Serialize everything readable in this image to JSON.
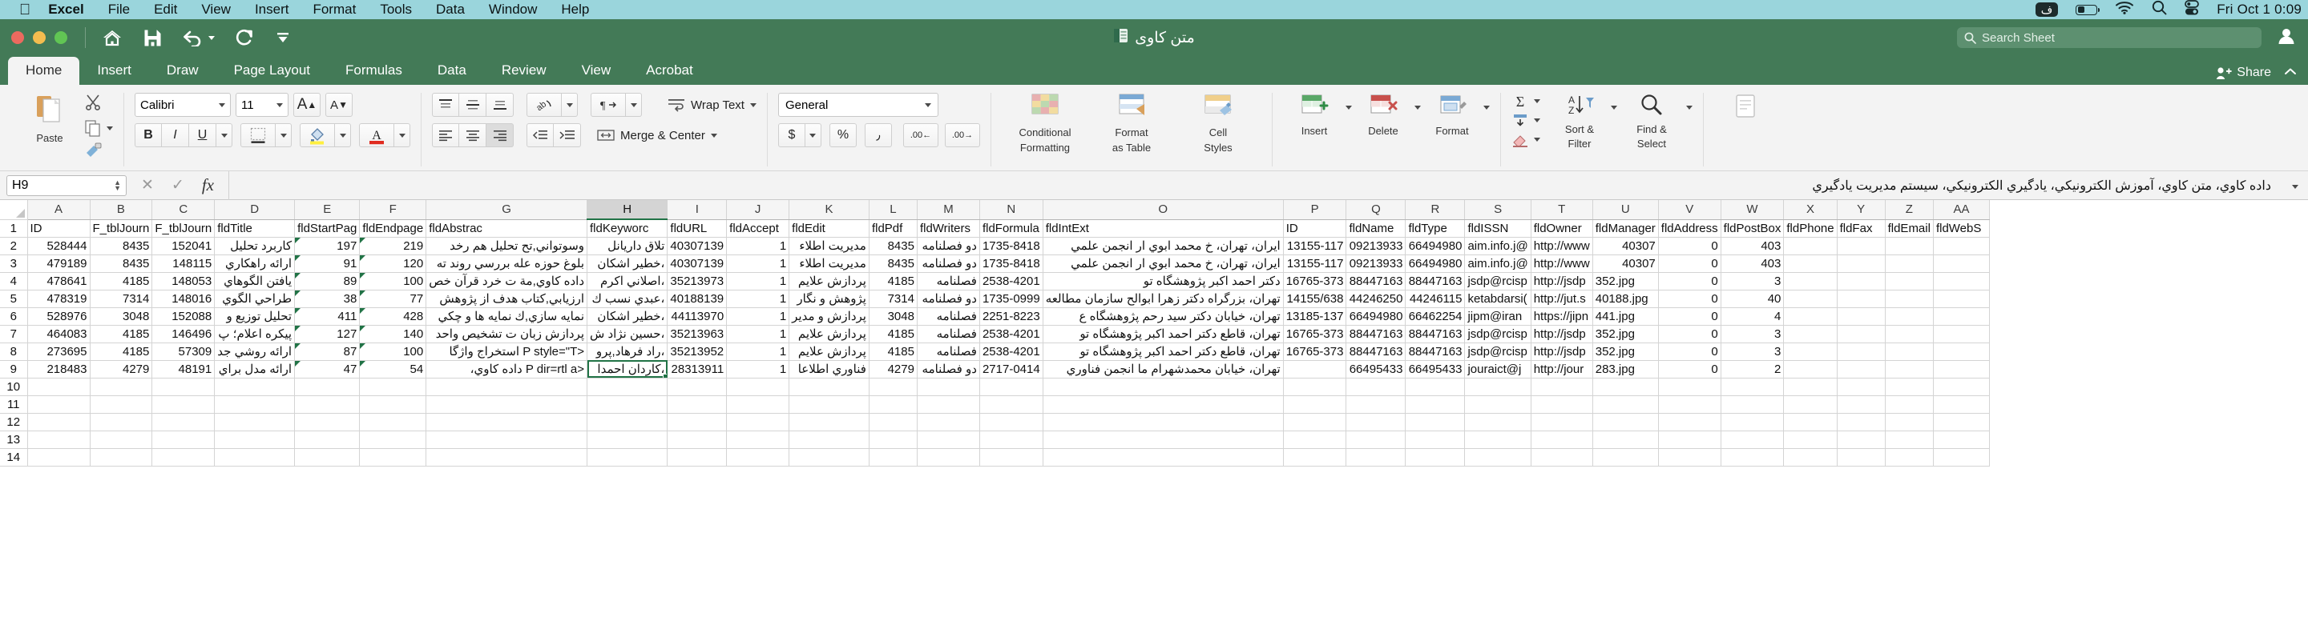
{
  "menubar": {
    "apple_icon": "apple-icon",
    "items": [
      "Excel",
      "File",
      "Edit",
      "View",
      "Insert",
      "Format",
      "Tools",
      "Data",
      "Window",
      "Help"
    ],
    "right": {
      "ime_label": "ف",
      "battery_icon": "battery-icon",
      "wifi_icon": "wifi-icon",
      "search_icon": "spotlight-search-icon",
      "control_center_icon": "control-center-icon",
      "clock": "Fri Oct 1  0:09"
    }
  },
  "window": {
    "title": "متن کاوی",
    "title_icon": "workbook-icon",
    "traffic_lights": [
      "close",
      "minimize",
      "zoom"
    ],
    "quick_access": [
      "home-icon",
      "save-icon",
      "undo-icon",
      "redo-icon",
      "customize-icon"
    ],
    "search_placeholder": "Search Sheet",
    "account_icon": "account-icon"
  },
  "ribbon": {
    "tabs": [
      "Home",
      "Insert",
      "Draw",
      "Page Layout",
      "Formulas",
      "Data",
      "Review",
      "View",
      "Acrobat"
    ],
    "active_tab": "Home",
    "share_label": "Share",
    "collapse_icon": "chevron-up-icon",
    "clipboard": {
      "paste_label": "Paste",
      "cut_icon": "scissors-icon",
      "copy_icon": "copy-icon",
      "format_painter_icon": "format-painter-icon"
    },
    "font": {
      "font_name": "Calibri",
      "font_size": "11",
      "grow_font": "A",
      "shrink_font": "A",
      "bold": "B",
      "italic": "I",
      "underline": "U",
      "borders_icon": "borders-icon",
      "fill_color_icon": "fill-color-icon",
      "fill_color": "#ffef3f",
      "font_color_icon": "font-color-icon",
      "font_color": "#e02b20"
    },
    "alignment": {
      "align_top_icon": "align-top-icon",
      "align_middle_icon": "align-middle-icon",
      "align_bottom_icon": "align-bottom-icon",
      "orientation_icon": "orientation-icon",
      "text_direction_icon": "text-direction-icon",
      "align_left_icon": "align-left-icon",
      "align_center_icon": "align-center-icon",
      "align_right_icon": "align-right-icon",
      "decrease_indent_icon": "decrease-indent-icon",
      "increase_indent_icon": "increase-indent-icon",
      "wrap_text_label": "Wrap Text",
      "merge_center_label": "Merge & Center"
    },
    "number": {
      "format": "General",
      "currency": "$",
      "percent": "%",
      "comma": "٫",
      "decrease_decimal": ".00",
      "increase_decimal": ".00"
    },
    "styles": {
      "conditional_formatting": "Conditional\nFormatting",
      "conditional_line1": "Conditional",
      "conditional_line2": "Formatting",
      "format_as_table_line1": "Format",
      "format_as_table_line2": "as Table",
      "cell_styles_line1": "Cell",
      "cell_styles_line2": "Styles"
    },
    "cells": {
      "insert_label": "Insert",
      "delete_label": "Delete",
      "format_label": "Format"
    },
    "editing": {
      "autosum_icon": "autosum-icon",
      "fill_icon": "fill-icon",
      "clear_icon": "clear-icon",
      "sort_filter_line1": "Sort &",
      "sort_filter_line2": "Filter",
      "find_select_line1": "Find &",
      "find_select_line2": "Select"
    },
    "sensitivity_icon": "sensitivity-icon"
  },
  "formula_bar": {
    "name_box": "H9",
    "cancel_icon": "cancel-icon",
    "enter_icon": "confirm-icon",
    "function_icon": "fx-icon",
    "value": "داده کاوي، متن کاوي، آموزش الکترونیکي، یادگیري الکترونیکي، سیستم مدیریت یادگیري",
    "expand_icon": "expand-formula-bar-icon"
  },
  "sheet": {
    "selected_cell": "H9",
    "selected_column": "H",
    "selected_row": 9,
    "columns": [
      {
        "label": "A",
        "width": 78
      },
      {
        "label": "B",
        "width": 74
      },
      {
        "label": "C",
        "width": 74
      },
      {
        "label": "D",
        "width": 78
      },
      {
        "label": "E",
        "width": 74
      },
      {
        "label": "F",
        "width": 74
      },
      {
        "label": "G",
        "width": 78
      },
      {
        "label": "H",
        "width": 78
      },
      {
        "label": "I",
        "width": 60
      },
      {
        "label": "J",
        "width": 78
      },
      {
        "label": "K",
        "width": 78
      },
      {
        "label": "L",
        "width": 60
      },
      {
        "label": "M",
        "width": 78
      },
      {
        "label": "N",
        "width": 78
      },
      {
        "label": "O",
        "width": 70
      },
      {
        "label": "P",
        "width": 74
      },
      {
        "label": "Q",
        "width": 74
      },
      {
        "label": "R",
        "width": 74
      },
      {
        "label": "S",
        "width": 74
      },
      {
        "label": "T",
        "width": 74
      },
      {
        "label": "U",
        "width": 80
      },
      {
        "label": "V",
        "width": 74
      },
      {
        "label": "W",
        "width": 74
      },
      {
        "label": "X",
        "width": 60
      },
      {
        "label": "Y",
        "width": 60
      },
      {
        "label": "Z",
        "width": 60
      },
      {
        "label": "AA",
        "width": 70
      }
    ],
    "row_numbers": [
      1,
      2,
      3,
      4,
      5,
      6,
      7,
      8,
      9,
      10,
      11,
      12,
      13,
      14
    ],
    "header_row": [
      "ID",
      "F_tblJourn",
      "F_tblJourn",
      "fldTitle",
      "fldStartPag",
      "fldEndpage",
      "fldAbstrac",
      "fldKeyworc",
      "fldURL",
      "fldAccept",
      "fldEdit",
      "fldPdf",
      "fldWriters",
      "fldFormula",
      "fldIntExt",
      "ID",
      "fldName",
      "fldType",
      "fldISSN",
      "fldOwner",
      "fldManager",
      "fldAddress",
      "fldPostBox",
      "fldPhone",
      "fldFax",
      "fldEmail",
      "fldWebS"
    ],
    "rows": [
      {
        "n": 2,
        "cells": [
          "528444",
          "8435",
          "152041",
          "كاربرد تحليل",
          "197",
          "219",
          "وسوتواني,تح تحليل هم رخد",
          "تلاق داريانل",
          "40307139",
          "1",
          "مديريت اطلاء",
          "8435",
          "دو فصلنامه",
          "1735-8418",
          "ايران، تهران، خ محمد ابوي ار انجمن علمي",
          "13155-117",
          "09213933",
          "66494980",
          "aim.info.j@",
          "http://www",
          "40307",
          "0",
          "403",
          "",
          "",
          ""
        ]
      },
      {
        "n": 3,
        "cells": [
          "479189",
          "8435",
          "148115",
          "ارائه راهكاري",
          "91",
          "120",
          "بلوغ حوزه عله بررسي روند ته",
          "،خطير اشكان",
          "40307139",
          "1",
          "مديريت اطلاء",
          "8435",
          "دو فصلنامه",
          "1735-8418",
          "ايران، تهران، خ محمد ابوي ار انجمن علمي",
          "13155-117",
          "09213933",
          "66494980",
          "aim.info.j@",
          "http://www",
          "40307",
          "0",
          "403",
          "",
          "",
          ""
        ]
      },
      {
        "n": 4,
        "cells": [
          "478641",
          "4185",
          "148053",
          "يافتن الگوهاي",
          "89",
          "100",
          "داده كاوي,مة ت خرد قرآن خص",
          "،اصلاني اكرم",
          "35213973",
          "1",
          "پردازش علايم",
          "4185",
          "فصلنامه",
          "2538-4201",
          "دكتر احمد اكبر پژوهشگاه تو",
          "16765-373",
          "88447163",
          "88447163",
          "jsdp@rcisp",
          "http://jsdp",
          "352.jpg",
          "0",
          "3",
          "",
          "",
          ""
        ]
      },
      {
        "n": 5,
        "cells": [
          "478319",
          "7314",
          "148016",
          "طراحي الگوي",
          "38",
          "77",
          "ارزيابي,كتاب هدف از پژوهش",
          "،عبدي نسب ك",
          "40188139",
          "1",
          "پژوهش و نگار",
          "7314",
          "دو فصلنامه",
          "1735-0999",
          "تهران، بزرگراه دكتر زهرا ابوالح سازمان مطالعه",
          "14155/638",
          "44246250",
          "44246115",
          "ketabdarsi(",
          "http://jut.s",
          "40188.jpg",
          "0",
          "40",
          "",
          "",
          ""
        ]
      },
      {
        "n": 6,
        "cells": [
          "528976",
          "3048",
          "152088",
          "تحليل توزيع و",
          "411",
          "428",
          "نمايه سازي,ك نمايه ها و چكي",
          "،خطير اشكان",
          "44113970",
          "1",
          "پردازش و مدير",
          "3048",
          "فصلنامه",
          "2251-8223",
          "تهران، خيابان دكتر سيد رحم پژوهشگاه ع",
          "13185-137",
          "66494980",
          "66462254",
          "jipm@iran",
          "https://jipn",
          "441.jpg",
          "0",
          "4",
          "",
          "",
          ""
        ]
      },
      {
        "n": 7,
        "cells": [
          "464083",
          "4185",
          "146496",
          "پيكره اعلام؛ پ",
          "127",
          "140",
          "پردازش زبان ت تشخيص واحد",
          "،حسين نژاد ش",
          "35213963",
          "1",
          "پردازش علايم",
          "4185",
          "فصلنامه",
          "2538-4201",
          "تهران، قاطع دكتر احمد اكبر پژوهشگاه تو",
          "16765-373",
          "88447163",
          "88447163",
          "jsdp@rcisp",
          "http://jsdp",
          "352.jpg",
          "0",
          "3",
          "",
          "",
          ""
        ]
      },
      {
        "n": 8,
        "cells": [
          "273695",
          "4185",
          "57309",
          "ارائه روشي جد",
          "87",
          "100",
          "<P style=\"T استخراج واژگا",
          "،راد فرهاد,پرو",
          "35213952",
          "1",
          "پردازش علايم",
          "4185",
          "فصلنامه",
          "2538-4201",
          "تهران، قاطع دكتر احمد اكبر پژوهشگاه تو",
          "16765-373",
          "88447163",
          "88447163",
          "jsdp@rcisp",
          "http://jsdp",
          "352.jpg",
          "0",
          "3",
          "",
          "",
          ""
        ]
      },
      {
        "n": 9,
        "cells": [
          "218483",
          "4279",
          "48191",
          "ارائه مدل براي",
          "47",
          "54",
          "<P dir=rtl a داده كاوي، ",
          "،كاردان احمدا",
          "28313911",
          "1",
          "فناوري اطلاعا",
          "4279",
          "دو فصلنامه",
          "2717-0414",
          "تهران، خيابان محمدشهرام ما انجمن فناوري",
          "",
          "66495433",
          "66495433",
          "jouraict@j",
          "http://jour",
          "283.jpg",
          "0",
          "2",
          "",
          "",
          ""
        ]
      }
    ],
    "empty_rows": [
      10,
      11,
      12,
      13,
      14
    ]
  }
}
